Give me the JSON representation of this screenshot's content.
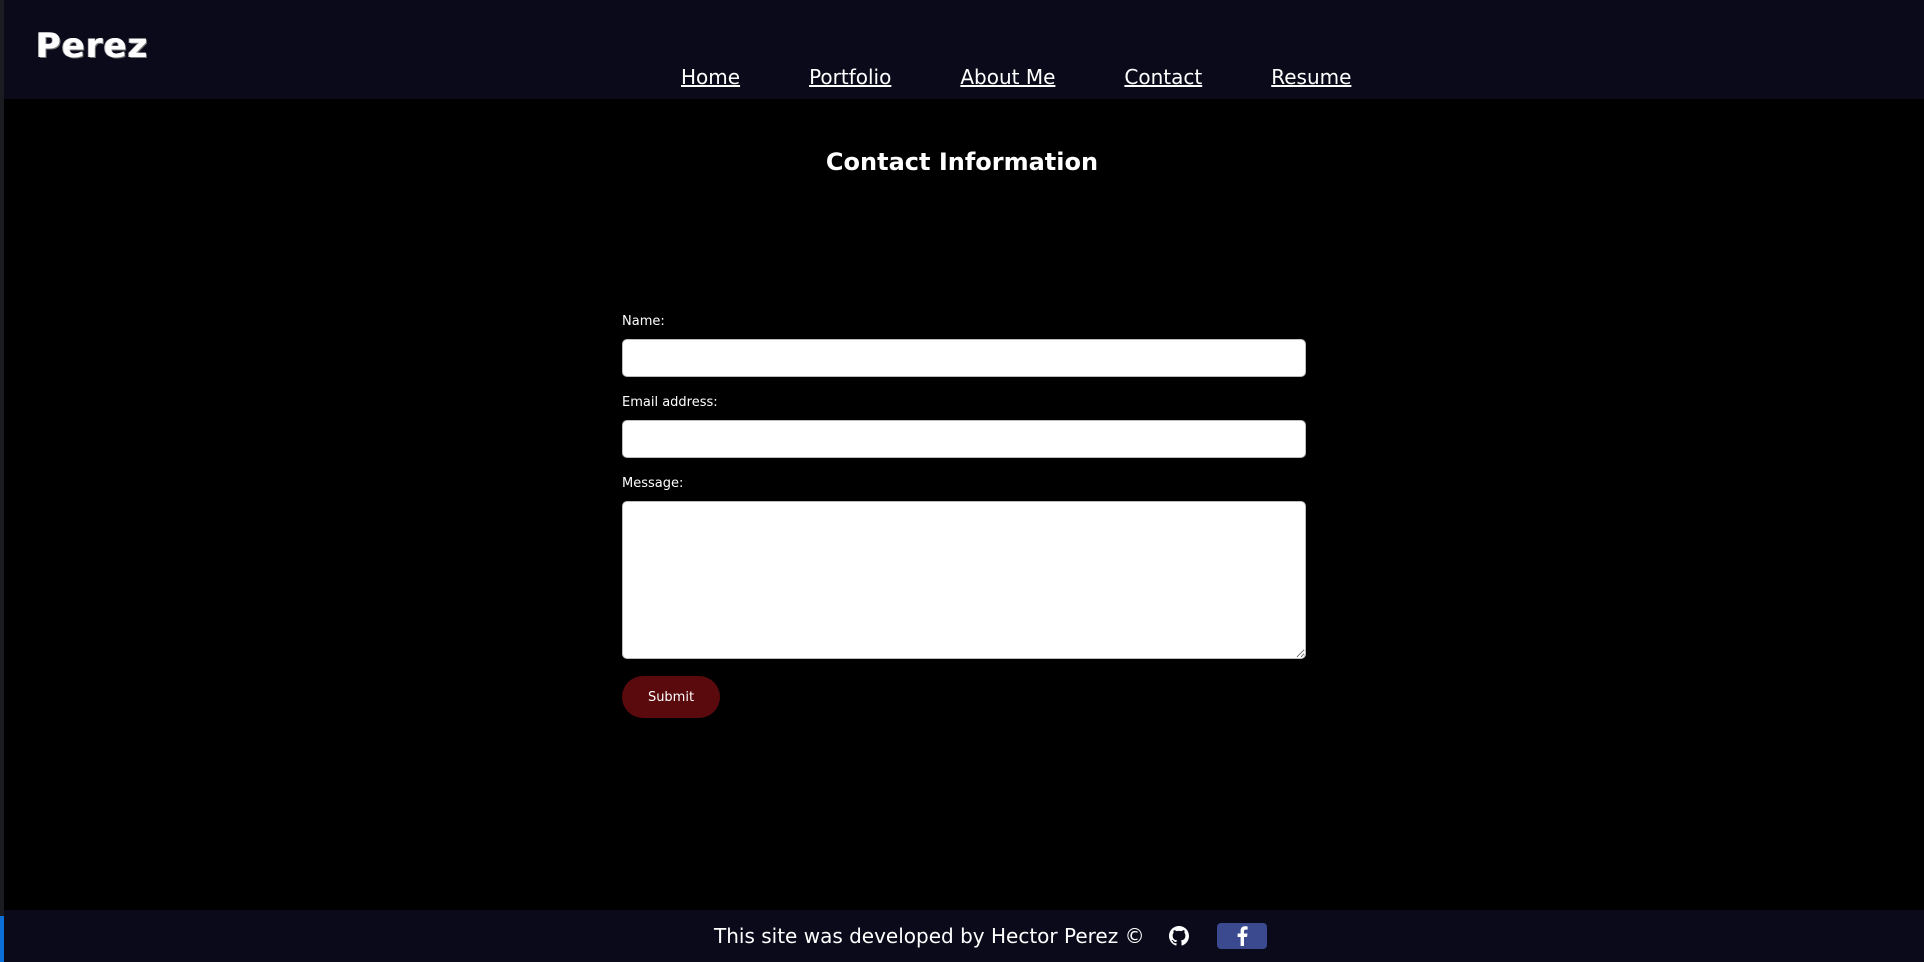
{
  "header": {
    "logo_text": "Perez",
    "nav": [
      {
        "label": "Home"
      },
      {
        "label": "Portfolio"
      },
      {
        "label": "About Me"
      },
      {
        "label": "Contact"
      },
      {
        "label": "Resume"
      }
    ]
  },
  "main": {
    "title": "Contact Information",
    "form": {
      "name_label": "Name:",
      "name_value": "",
      "email_label": "Email address:",
      "email_value": "",
      "message_label": "Message:",
      "message_value": "",
      "submit_label": "Submit"
    }
  },
  "footer": {
    "text": "This site was developed by Hector Perez ©",
    "icons": [
      "github-icon",
      "facebook-icon"
    ]
  },
  "colors": {
    "header_bg": "#0a0a1a",
    "page_bg": "#000000",
    "submit_bg": "#5a0a0d",
    "facebook_bg": "#3b4a8f"
  }
}
